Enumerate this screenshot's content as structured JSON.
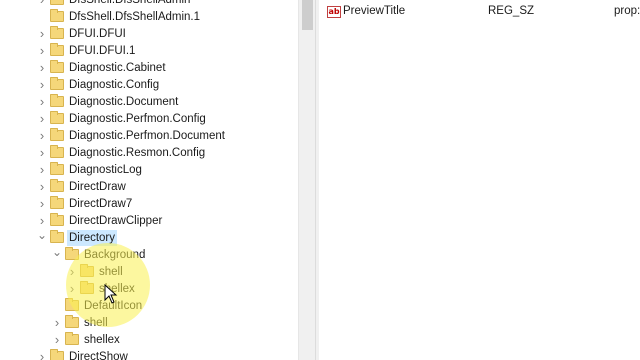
{
  "tree": {
    "items": [
      {
        "label": "DfsShell.DfsShellAdmin",
        "level": 0,
        "chevron": "right"
      },
      {
        "label": "DfsShell.DfsShellAdmin.1",
        "level": 0,
        "chevron": "none"
      },
      {
        "label": "DFUI.DFUI",
        "level": 0,
        "chevron": "right"
      },
      {
        "label": "DFUI.DFUI.1",
        "level": 0,
        "chevron": "right"
      },
      {
        "label": "Diagnostic.Cabinet",
        "level": 0,
        "chevron": "right"
      },
      {
        "label": "Diagnostic.Config",
        "level": 0,
        "chevron": "right"
      },
      {
        "label": "Diagnostic.Document",
        "level": 0,
        "chevron": "right"
      },
      {
        "label": "Diagnostic.Perfmon.Config",
        "level": 0,
        "chevron": "right"
      },
      {
        "label": "Diagnostic.Perfmon.Document",
        "level": 0,
        "chevron": "right"
      },
      {
        "label": "Diagnostic.Resmon.Config",
        "level": 0,
        "chevron": "right"
      },
      {
        "label": "DiagnosticLog",
        "level": 0,
        "chevron": "right"
      },
      {
        "label": "DirectDraw",
        "level": 0,
        "chevron": "right"
      },
      {
        "label": "DirectDraw7",
        "level": 0,
        "chevron": "right"
      },
      {
        "label": "DirectDrawClipper",
        "level": 0,
        "chevron": "right"
      },
      {
        "label": "Directory",
        "level": 0,
        "chevron": "down",
        "selected": true
      },
      {
        "label": "Background",
        "level": 1,
        "chevron": "down"
      },
      {
        "label": "shell",
        "level": 2,
        "chevron": "right"
      },
      {
        "label": "shellex",
        "level": 2,
        "chevron": "right"
      },
      {
        "label": "DefaultIcon",
        "level": 1,
        "chevron": "none"
      },
      {
        "label": "shell",
        "level": 1,
        "chevron": "right"
      },
      {
        "label": "shellex",
        "level": 1,
        "chevron": "right"
      },
      {
        "label": "DirectShow",
        "level": 0,
        "chevron": "right"
      }
    ]
  },
  "values": {
    "rows": [
      {
        "icon": "ab",
        "name": "PreviewTitle",
        "type": "REG_SZ",
        "data": "prop:Sy"
      }
    ]
  }
}
